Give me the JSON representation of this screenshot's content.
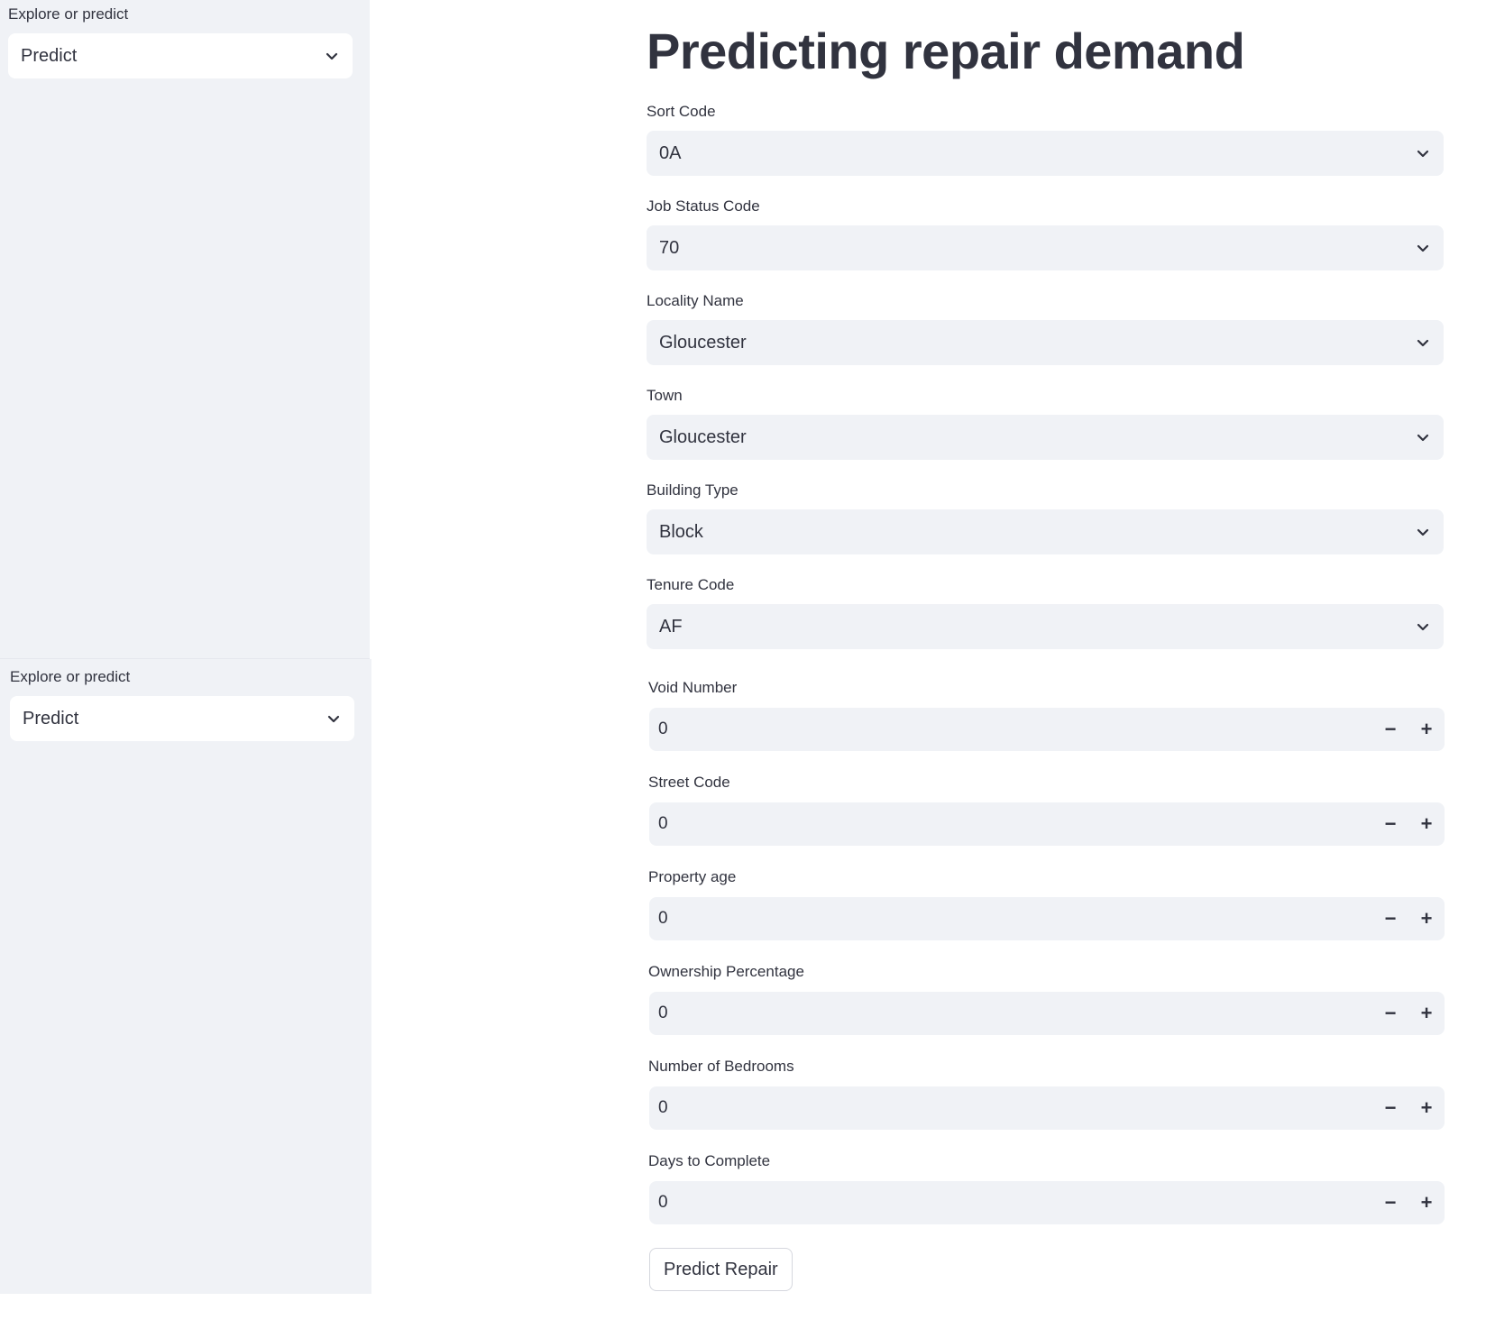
{
  "sidebar": [
    {
      "label": "Explore or predict",
      "value": "Predict"
    },
    {
      "label": "Explore or predict",
      "value": "Predict"
    }
  ],
  "main": {
    "title": "Predicting repair demand",
    "selects": [
      {
        "label": "Sort Code",
        "value": "0A"
      },
      {
        "label": "Job Status Code",
        "value": "70"
      },
      {
        "label": "Locality Name",
        "value": "Gloucester"
      },
      {
        "label": "Town",
        "value": "Gloucester"
      },
      {
        "label": "Building Type",
        "value": "Block"
      },
      {
        "label": "Tenure Code",
        "value": "AF"
      }
    ],
    "numbers": [
      {
        "label": "Void Number",
        "value": "0"
      },
      {
        "label": "Street Code",
        "value": "0"
      },
      {
        "label": "Property age",
        "value": "0"
      },
      {
        "label": "Ownership Percentage",
        "value": "0"
      },
      {
        "label": "Number of Bedrooms",
        "value": "0"
      },
      {
        "label": "Days to Complete",
        "value": "0"
      }
    ],
    "minus_symbol": "−",
    "plus_symbol": "+",
    "button_label": "Predict Repair"
  }
}
